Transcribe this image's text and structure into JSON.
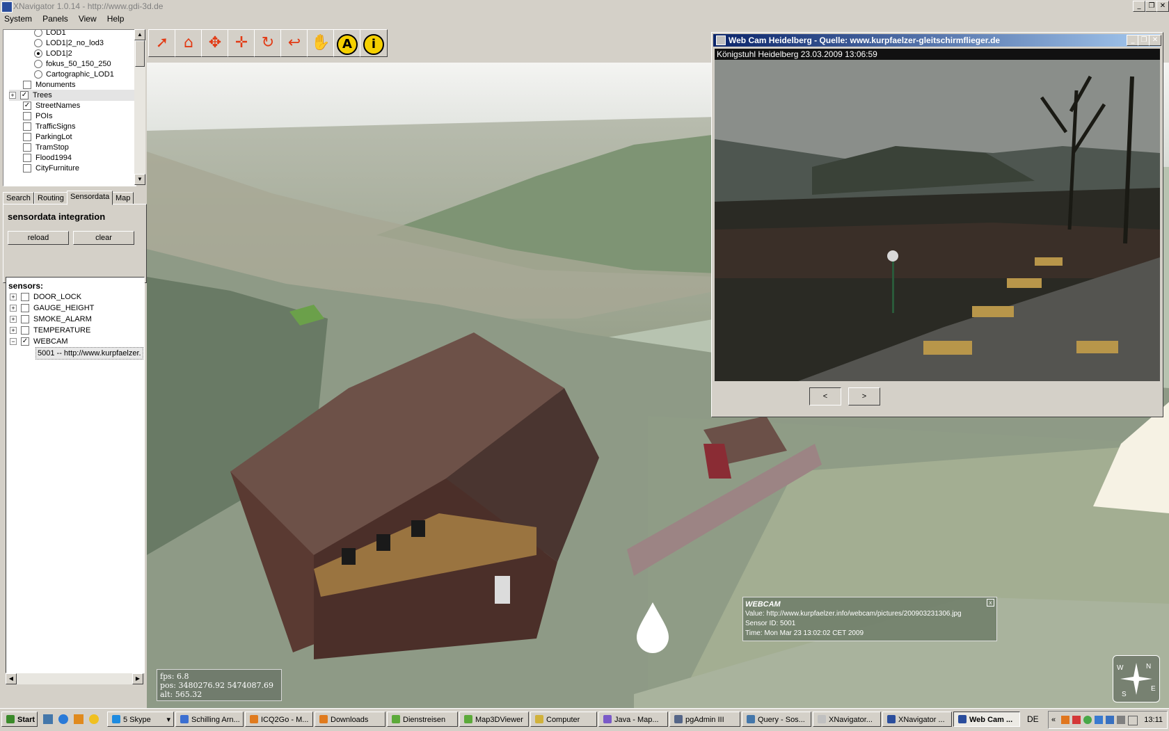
{
  "window": {
    "title": "XNavigator 1.0.14 - http://www.gdi-3d.de",
    "minimize_glyph": "_",
    "restore_glyph": "❐",
    "close_glyph": "✕"
  },
  "menu": [
    "System",
    "Panels",
    "View",
    "Help"
  ],
  "layer_tree": {
    "lod_options": [
      {
        "label": "LOD1",
        "selected": false
      },
      {
        "label": "LOD1|2_no_lod3",
        "selected": false
      },
      {
        "label": "LOD1|2",
        "selected": true
      },
      {
        "label": "fokus_50_150_250",
        "selected": false
      },
      {
        "label": "Cartographic_LOD1",
        "selected": false
      }
    ],
    "layers": [
      {
        "label": "Monuments",
        "checked": false,
        "expandable": false
      },
      {
        "label": "Trees",
        "checked": true,
        "expandable": true
      },
      {
        "label": "StreetNames",
        "checked": true,
        "expandable": false
      },
      {
        "label": "POIs",
        "checked": false,
        "expandable": false
      },
      {
        "label": "TrafficSigns",
        "checked": false,
        "expandable": false
      },
      {
        "label": "ParkingLot",
        "checked": false,
        "expandable": false
      },
      {
        "label": "TramStop",
        "checked": false,
        "expandable": false
      },
      {
        "label": "Flood1994",
        "checked": false,
        "expandable": false
      },
      {
        "label": "CityFurniture",
        "checked": false,
        "expandable": false
      }
    ]
  },
  "tabs": [
    {
      "label": "Search",
      "active": false
    },
    {
      "label": "Routing",
      "active": false
    },
    {
      "label": "Sensordata",
      "active": true
    },
    {
      "label": "Map",
      "active": false
    }
  ],
  "sensordata": {
    "heading": "sensordata integration",
    "reload_label": "reload",
    "clear_label": "clear",
    "sensors_heading": "sensors:",
    "sensors": [
      {
        "label": "DOOR_LOCK",
        "checked": false,
        "expanded": false
      },
      {
        "label": "GAUGE_HEIGHT",
        "checked": false,
        "expanded": false
      },
      {
        "label": "SMOKE_ALARM",
        "checked": false,
        "expanded": false
      },
      {
        "label": "TEMPERATURE",
        "checked": false,
        "expanded": false
      },
      {
        "label": "WEBCAM",
        "checked": true,
        "expanded": true
      }
    ],
    "webcam_child": "5001 -- http://www.kurpfaelzer."
  },
  "toolbar": {
    "tools": [
      {
        "name": "fly-tool",
        "glyph": "➚"
      },
      {
        "name": "home-tool",
        "glyph": "⌂"
      },
      {
        "name": "move-tool",
        "glyph": "✥"
      },
      {
        "name": "pan-tool",
        "glyph": "✛"
      },
      {
        "name": "rotate-tool",
        "glyph": "↻"
      },
      {
        "name": "back-tool",
        "glyph": "↩"
      },
      {
        "name": "hand-tool",
        "glyph": "✋"
      },
      {
        "name": "annotation-tool",
        "glyph": "A"
      },
      {
        "name": "info-tool",
        "glyph": "i"
      }
    ]
  },
  "status": {
    "fps": "fps: 6.8",
    "pos": "pos: 3480276.92  5474087.69",
    "alt": "alt: 565.32"
  },
  "compass": {
    "n": "N",
    "e": "E",
    "s": "S",
    "w": "W"
  },
  "popup": {
    "title": "WEBCAM",
    "value": "Value: http://www.kurpfaelzer.info/webcam/pictures/200903231306.jpg",
    "sensor_id": "Sensor ID: 5001",
    "time": "Time: Mon Mar 23 13:02:02 CET 2009",
    "close_glyph": "x"
  },
  "webcam_window": {
    "title": "Web Cam Heidelberg - Quelle: www.kurpfaelzer-gleitschirmflieger.de",
    "caption": "Königstuhl Heidelberg 23.03.2009 13:06:59",
    "prev_label": "<",
    "next_label": ">"
  },
  "taskbar": {
    "start_label": "Start",
    "buttons": [
      {
        "label": "5 Skype",
        "color": "#1e8be0",
        "active": false
      },
      {
        "label": "Schilling Arn...",
        "color": "#3b6fd1",
        "active": false
      },
      {
        "label": "ICQ2Go - M...",
        "color": "#e07b1e",
        "active": false
      },
      {
        "label": "Downloads",
        "color": "#e07b1e",
        "active": false
      },
      {
        "label": "Dienstreisen",
        "color": "#5caa3a",
        "active": false
      },
      {
        "label": "Map3DViewer",
        "color": "#5caa3a",
        "active": false
      },
      {
        "label": "Computer",
        "color": "#d1b23b",
        "active": false
      },
      {
        "label": "Java - Map...",
        "color": "#7a5ac8",
        "active": false
      },
      {
        "label": "pgAdmin III",
        "color": "#556688",
        "active": false
      },
      {
        "label": "Query - Sos...",
        "color": "#4477aa",
        "active": false
      },
      {
        "label": "XNavigator...",
        "color": "#c0c0c0",
        "active": false
      },
      {
        "label": "XNavigator ...",
        "color": "#2a4d9c",
        "active": false
      },
      {
        "label": "Web Cam ...",
        "color": "#2a4d9c",
        "active": true
      }
    ],
    "language": "DE",
    "clock": "13:11",
    "tray_chevron": "«"
  },
  "colors": {
    "accent_title": "#0a246a",
    "tool_red": "#e23a14"
  }
}
